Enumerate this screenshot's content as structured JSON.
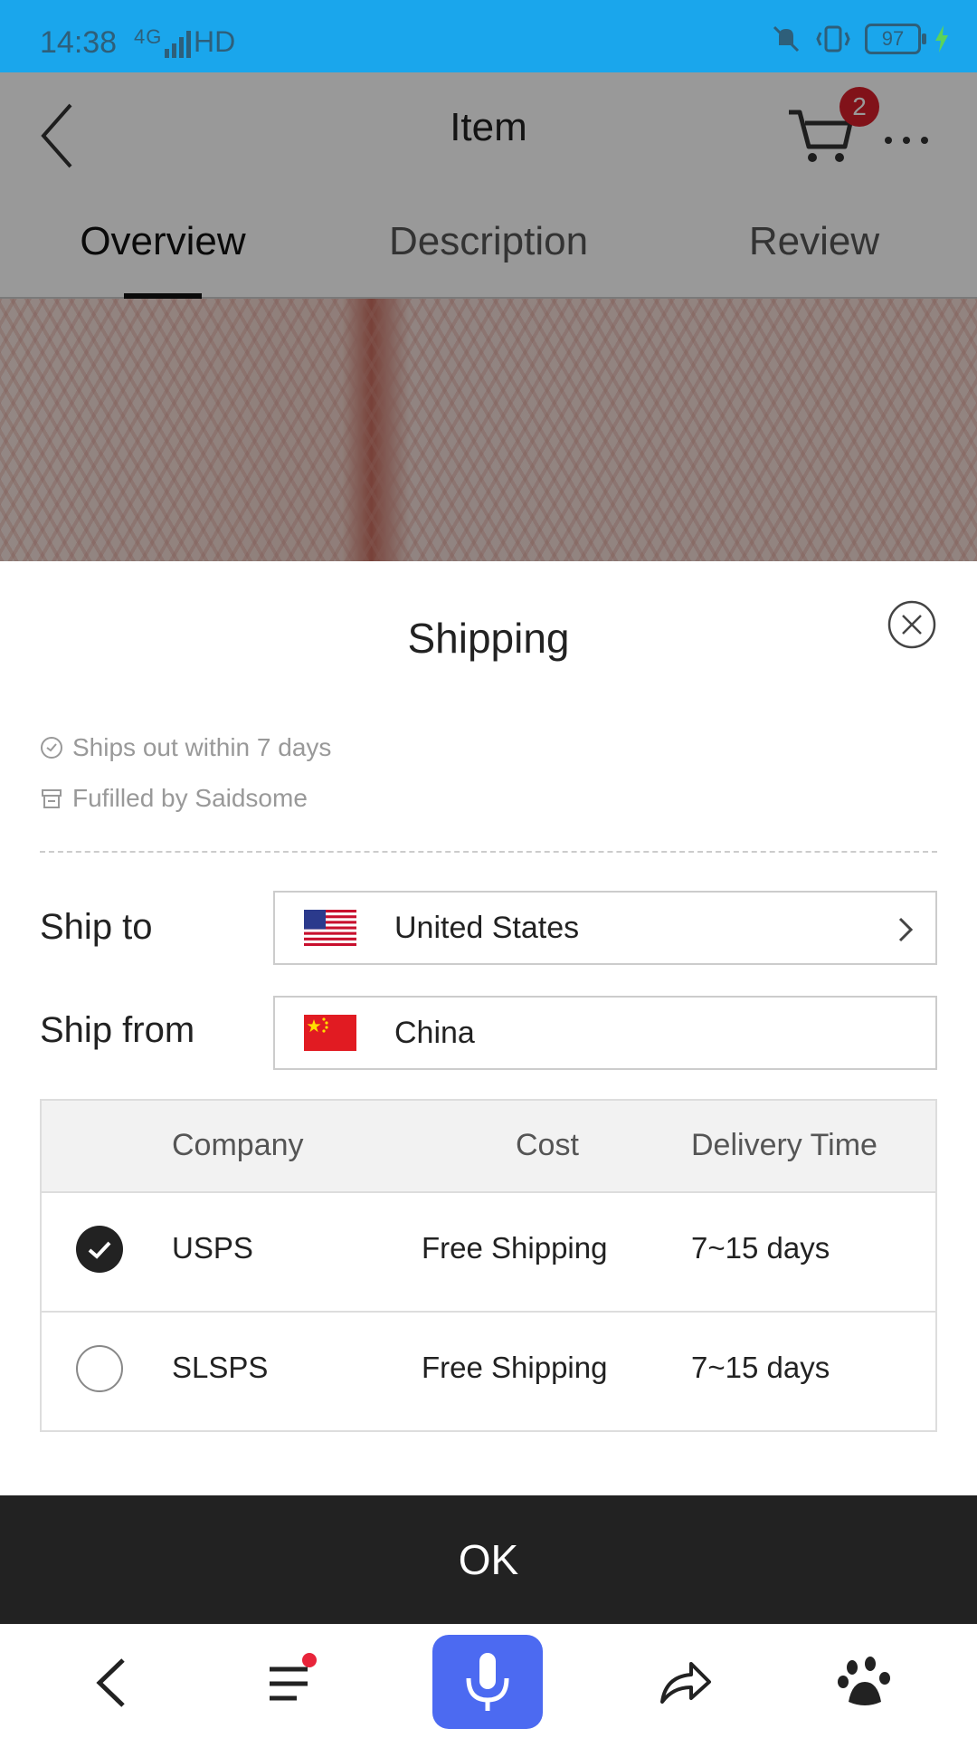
{
  "status_bar": {
    "time": "14:38",
    "network": "4G",
    "hd": "HD",
    "battery": "97"
  },
  "header": {
    "title": "Item",
    "cart_count": "2",
    "tabs": [
      {
        "label": "Overview",
        "active": true
      },
      {
        "label": "Description",
        "active": false
      },
      {
        "label": "Review",
        "active": false
      }
    ]
  },
  "shipping": {
    "title": "Shipping",
    "info": [
      {
        "icon": "clock-icon",
        "text": "Ships out within 7 days"
      },
      {
        "icon": "store-icon",
        "text": "Fufilled by Saidsome"
      }
    ],
    "ship_to": {
      "label": "Ship to",
      "value": "United States",
      "flag": "us-flag-icon"
    },
    "ship_from": {
      "label": "Ship from",
      "value": "China",
      "flag": "cn-flag-icon"
    },
    "table": {
      "headers": [
        "Company",
        "Cost",
        "Delivery Time"
      ],
      "rows": [
        {
          "company": "USPS",
          "cost": "Free Shipping",
          "time": "7~15 days",
          "selected": true
        },
        {
          "company": "SLSPS",
          "cost": "Free Shipping",
          "time": "7~15 days",
          "selected": false
        }
      ]
    },
    "ok_label": "OK"
  },
  "colors": {
    "status_bar": "#1aa6ec",
    "mic_button": "#4c6af1",
    "badge": "#d71f2a",
    "ok_button": "#222222"
  }
}
